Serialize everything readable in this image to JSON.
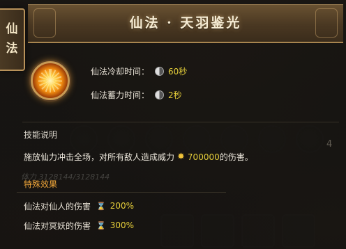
{
  "side_tab": {
    "label": "仙法"
  },
  "header": {
    "title": "仙法 · 天羽鉴光"
  },
  "skill": {
    "icon": "golden-sun-burst-icon",
    "cooldown_label": "仙法冷却时间：",
    "cooldown_value": "60秒",
    "charge_label": "仙法蓄力时间：",
    "charge_value": "2秒"
  },
  "description": {
    "heading": "技能说明",
    "text_before": "施放仙力冲击全场，对所有敌人造成威力",
    "power_value": "700000",
    "text_after": "的伤害。"
  },
  "special": {
    "heading": "特殊效果",
    "effects": [
      {
        "label": "仙法对仙人的伤害",
        "value": "200%"
      },
      {
        "label": "仙法对冥妖的伤害",
        "value": "300%"
      }
    ]
  },
  "background": {
    "faded_bar_text": "体力  3128144/3128144",
    "faded_count": "4"
  },
  "colors": {
    "accent_gold": "#c89a55",
    "value_yellow": "#e6cf3a",
    "heading_orange": "#f0a63a"
  }
}
